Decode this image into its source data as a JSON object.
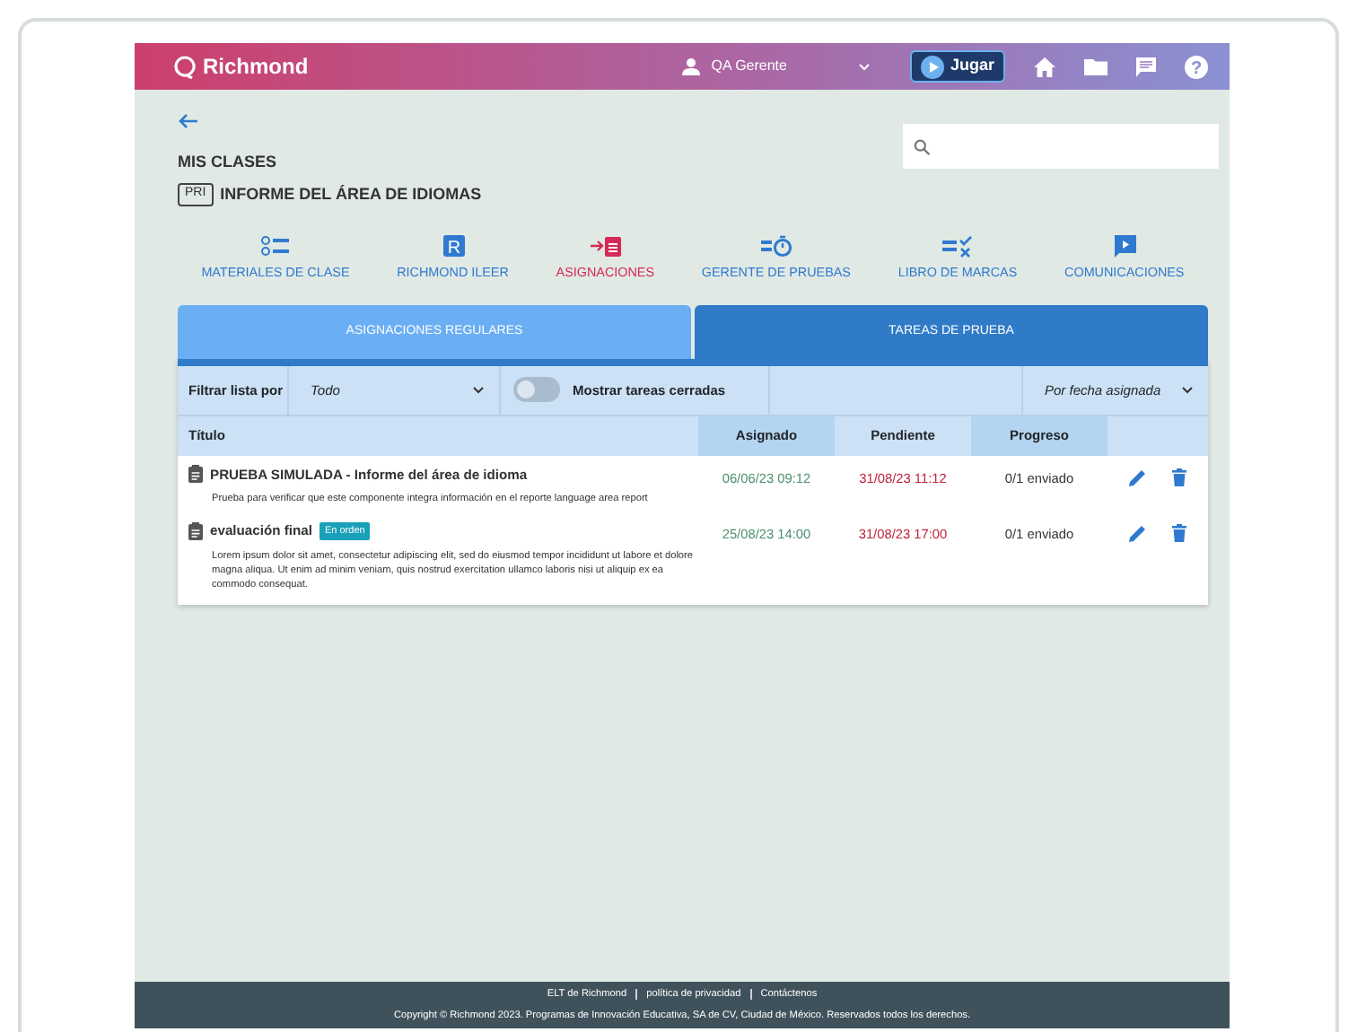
{
  "header": {
    "brand": "Richmond",
    "user": "QA Gerente",
    "play_button": "Jugar",
    "help_glyph": "?"
  },
  "breadcrumb": {
    "title": "MIS CLASES",
    "level_tag": "PRI",
    "subtitle": "INFORME DEL ÁREA DE IDIOMAS"
  },
  "nav": [
    {
      "kind": "materials",
      "label": "MATERIALES DE CLASE",
      "selected": false
    },
    {
      "kind": "reader",
      "glyph": "R",
      "label": "RICHMOND ILEER",
      "selected": false
    },
    {
      "kind": "assign",
      "label": "ASIGNACIONES",
      "selected": true
    },
    {
      "kind": "tests",
      "label": "GERENTE DE PRUEBAS",
      "selected": false
    },
    {
      "kind": "marks",
      "label": "LIBRO DE MARCAS",
      "selected": false
    },
    {
      "kind": "comms",
      "label": "COMUNICACIONES",
      "selected": false
    }
  ],
  "tabs": [
    {
      "label": "ASIGNACIONES REGULARES",
      "selected": false
    },
    {
      "label": "TAREAS DE PRUEBA",
      "selected": true
    }
  ],
  "filter": {
    "label": "Filtrar lista por",
    "value": "Todo",
    "toggle_label": "Mostrar tareas cerradas",
    "toggle_on": false,
    "sort": "Por fecha asignada"
  },
  "table": {
    "columns": [
      "Título",
      "Asignado",
      "Pendiente",
      "Progreso"
    ],
    "rows": [
      {
        "title": "PRUEBA SIMULADA - Informe del área de idioma",
        "badge": null,
        "description": "Prueba para verificar que este componente integra información en el reporte language area report",
        "assigned": "06/06/23 09:12",
        "due": "31/08/23 11:12",
        "progress": "0/1 enviado"
      },
      {
        "title": "evaluación final",
        "badge": "En orden",
        "description": "Lorem ipsum dolor sit amet, consectetur adipiscing elit, sed do eiusmod tempor incididunt ut labore et dolore magna aliqua. Ut enim ad minim veniam, quis nostrud exercitation ullamco laboris nisi ut aliquip ex ea commodo consequat.",
        "assigned": "25/08/23 14:00",
        "due": "31/08/23 17:00",
        "progress": "0/1 enviado"
      }
    ]
  },
  "footer": {
    "links": [
      "ELT de Richmond",
      "política de privacidad",
      "Contáctenos"
    ],
    "copyright": "Copyright © Richmond 2023. Programas de Innovación Educativa, SA de CV, Ciudad de México. Reservados todos los derechos."
  }
}
